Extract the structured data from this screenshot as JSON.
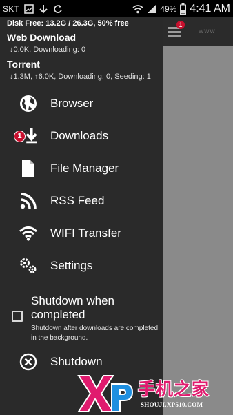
{
  "status_bar": {
    "carrier": "SKT",
    "battery_percent": "49%",
    "time": "4:41 AM",
    "icons": [
      "image-icon",
      "download-arrow-icon",
      "sync-icon",
      "wifi-icon",
      "signal-icon",
      "battery-icon"
    ]
  },
  "drawer": {
    "disk_info": "Disk Free: 13.2G / 26.3G, 50% free",
    "web_download": {
      "title": "Web Download",
      "stats": "↓0.0K, Downloading: 0"
    },
    "torrent": {
      "title": "Torrent",
      "stats": "↓1.3M, ↑6.0K, Downloading: 0, Seeding: 1"
    },
    "items": [
      {
        "label": "Browser",
        "icon": "globe-icon"
      },
      {
        "label": "Downloads",
        "icon": "download-icon",
        "badge": "1"
      },
      {
        "label": "File Manager",
        "icon": "file-icon"
      },
      {
        "label": "RSS Feed",
        "icon": "rss-icon"
      },
      {
        "label": "WIFI Transfer",
        "icon": "wifi-icon"
      },
      {
        "label": "Settings",
        "icon": "gears-icon"
      }
    ],
    "shutdown_option": {
      "title": "Shutdown when completed",
      "description": "Shutdown after downloads are completed in the background.",
      "checked": false
    },
    "shutdown": {
      "label": "Shutdown",
      "icon": "close-circle-icon"
    }
  },
  "background_app": {
    "badge": "1",
    "title": "www."
  },
  "watermark": {
    "logo": "XP",
    "text": "手机之家",
    "url": "SHOUJI.XP510.COM"
  },
  "colors": {
    "drawer_bg": "#2a2a2a",
    "app_bg": "#8a8a8a",
    "badge_red": "#c8102e",
    "watermark_pink": "#e01b6e"
  }
}
